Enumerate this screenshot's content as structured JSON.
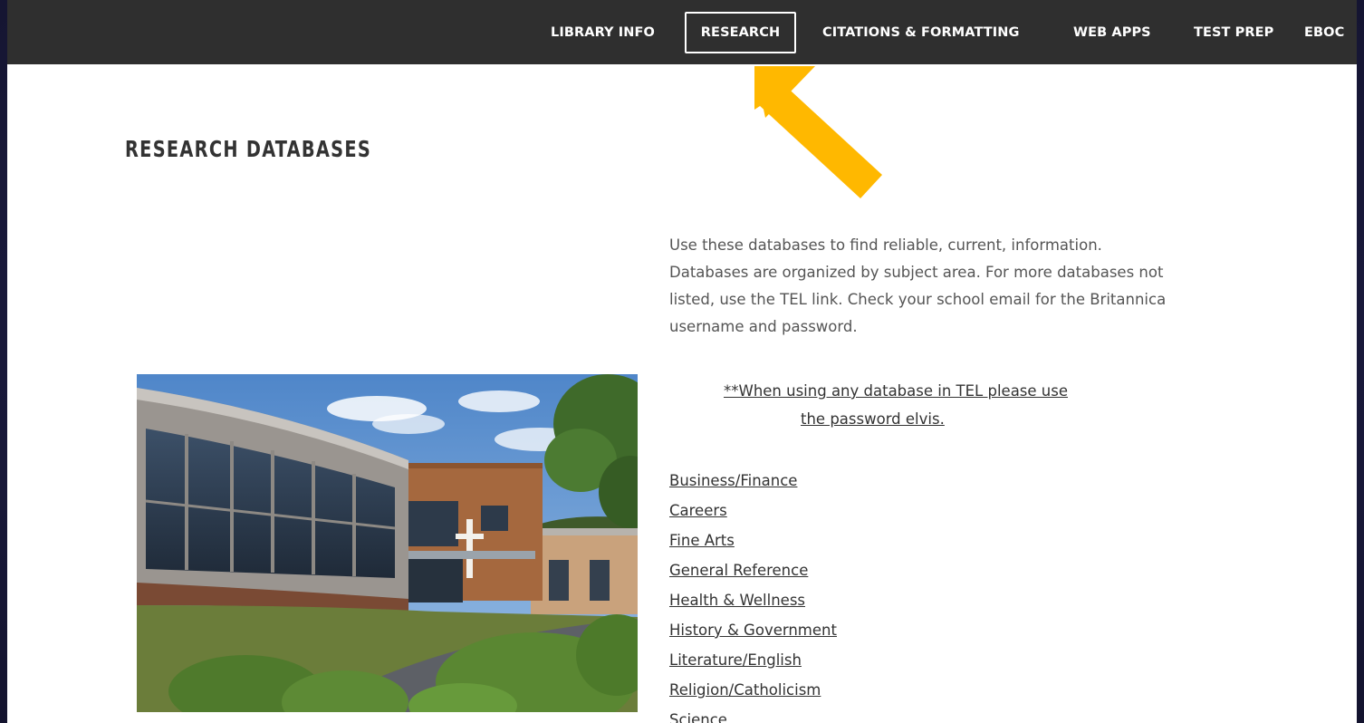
{
  "nav": {
    "items": [
      {
        "label": "LIBRARY INFO",
        "active": false
      },
      {
        "label": "RESEARCH",
        "active": true
      },
      {
        "label": "CITATIONS & FORMATTING",
        "active": false
      },
      {
        "label": "WEB APPS",
        "active": false
      },
      {
        "label": "TEST PREP",
        "active": false
      },
      {
        "label": "EBOC",
        "active": false
      }
    ]
  },
  "page": {
    "title": "RESEARCH DATABASES",
    "intro": "Use these databases to find reliable, current, information. Databases are organized by subject area. For more databases not listed, use the TEL link. Check your school email for the Britannica username and password.",
    "note_line1": "**When using any database in TEL please use",
    "note_line2": "the password elvis."
  },
  "links": [
    "Business/Finance",
    "Careers",
    "Fine Arts",
    "General Reference",
    "Health & Wellness",
    "History & Government",
    "Literature/English",
    "Religion/Catholicism",
    "Science"
  ],
  "colors": {
    "background": "#1c1c40",
    "navbar": "#2f2f2f",
    "arrow": "#ffb800",
    "text": "#555555"
  }
}
